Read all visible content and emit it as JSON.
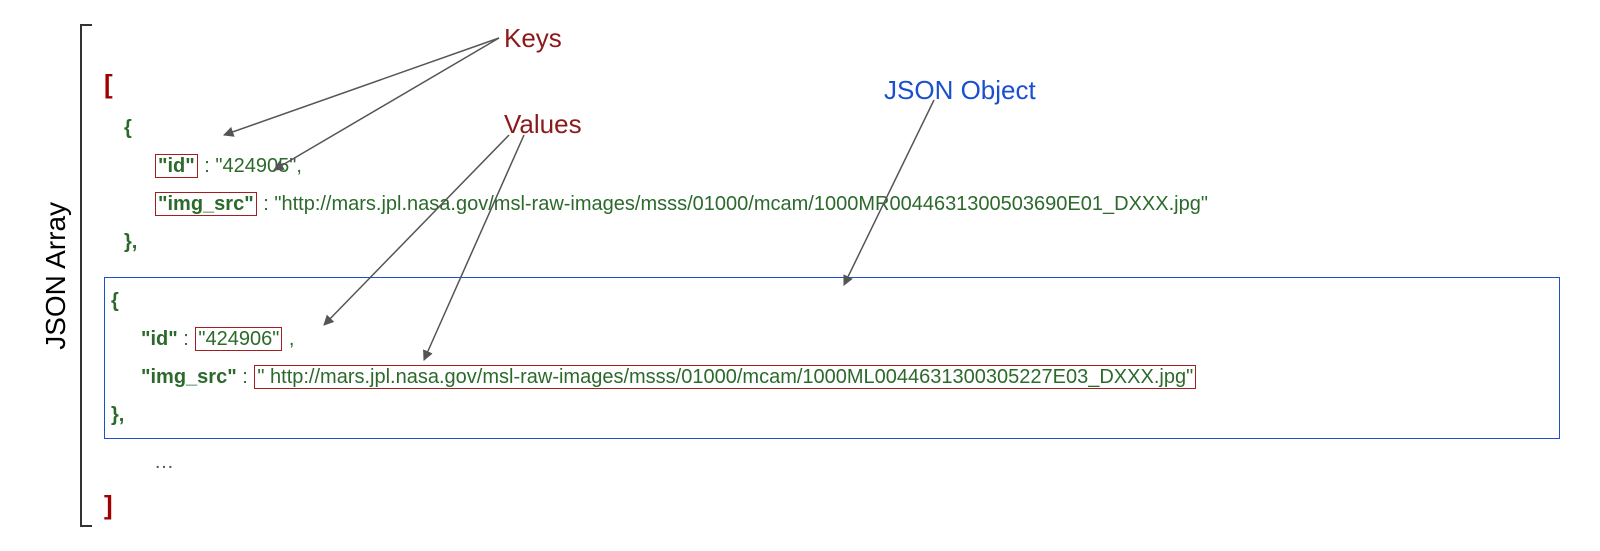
{
  "labels": {
    "array_label": "JSON Array",
    "keys_label": "Keys",
    "values_label": "Values",
    "object_label": "JSON Object",
    "open_bracket": "[",
    "close_bracket": "]",
    "open_brace": "{",
    "close_brace": "}",
    "brace_comma": "},",
    "colon_sep": " : ",
    "comma": ",",
    "ellipsis": "…"
  },
  "obj1": {
    "key_id": "\"id\"",
    "val_id": "\"424905\"",
    "key_src": "\"img_src\"",
    "val_src": "\"http://mars.jpl.nasa.gov/msl-raw-images/msss/01000/mcam/1000MR0044631300503690E01_DXXX.jpg\""
  },
  "obj2": {
    "key_id": "\"id\"",
    "val_id": "\"424906\"",
    "key_src": "\"img_src\"",
    "val_src": "\" http://mars.jpl.nasa.gov/msl-raw-images/msss/01000/mcam/1000ML0044631300305227E03_DXXX.jpg\""
  }
}
